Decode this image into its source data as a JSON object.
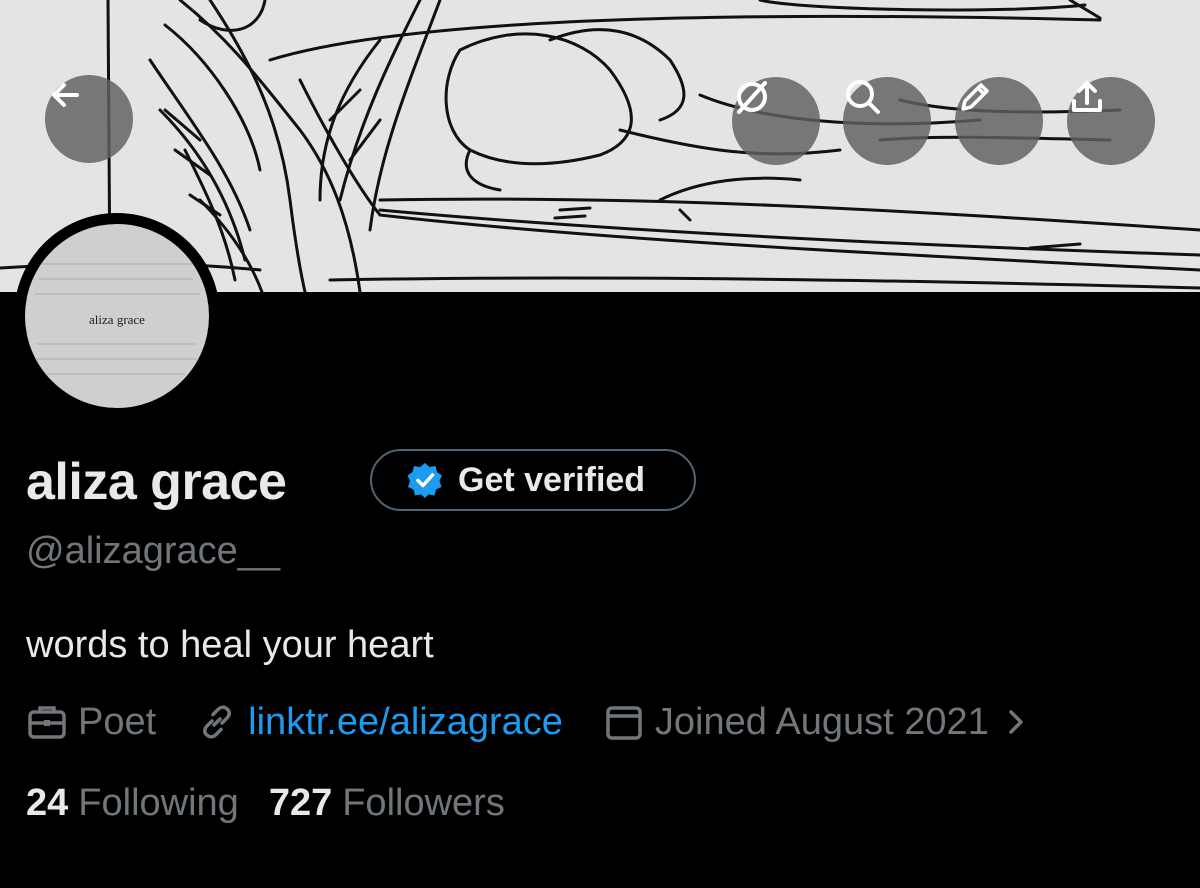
{
  "profile": {
    "display_name": "aliza grace",
    "handle": "@alizagrace__",
    "bio": "words to heal your heart",
    "avatar_text": "aliza grace",
    "occupation": "Poet",
    "website": "linktr.ee/alizagrace",
    "joined": "Joined August 2021"
  },
  "header": {
    "get_verified_label": "Get verified",
    "icons": [
      "back-arrow-icon",
      "grok-icon",
      "search-icon",
      "pencil-icon",
      "share-icon"
    ]
  },
  "stats": {
    "following_count": "24",
    "following_label": "Following",
    "followers_count": "727",
    "followers_label": "Followers"
  },
  "colors": {
    "background": "#000000",
    "link": "#1d9bf0",
    "secondary_text": "#71767b",
    "verified_badge": "#1d9bf0"
  }
}
